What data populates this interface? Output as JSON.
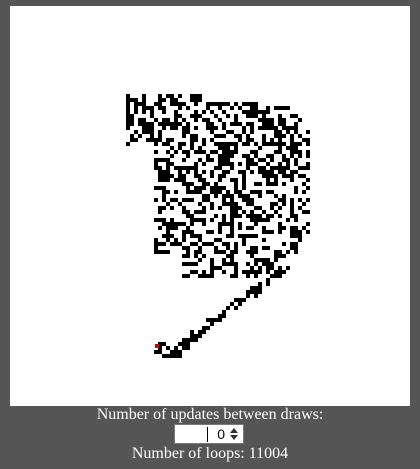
{
  "controls": {
    "updates_label": "Number of updates between draws:",
    "updates_value": "0",
    "loops_label": "Number of loops:",
    "loops_value": "11004",
    "loops_text": "Number of loops: 11004"
  },
  "canvas": {
    "background": "#ffffff",
    "cell_color": "#000000",
    "agent_color": "#cc0000",
    "page_background": "#555555"
  },
  "icons": {
    "spinner_up": "chevron-up-icon",
    "spinner_down": "chevron-down-icon"
  }
}
